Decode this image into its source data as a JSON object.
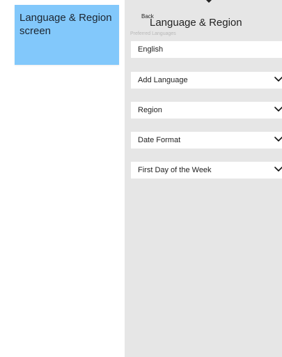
{
  "caption": {
    "text": "Language & Region screen"
  },
  "nav": {
    "back_label": "Back",
    "title": "Language & Region"
  },
  "section": {
    "header": "Preferred Languages"
  },
  "rows": [
    {
      "label": "English",
      "icon": "none"
    },
    {
      "label": "Add Language",
      "icon": "chevron-down-icon"
    },
    {
      "label": "Region",
      "icon": "chevron-down-icon"
    },
    {
      "label": "Date Format",
      "icon": "chevron-down-icon"
    },
    {
      "label": "First Day of the Week",
      "icon": "chevron-down-icon"
    }
  ],
  "colors": {
    "caption_bg": "#82c8fb",
    "screen_bg": "#e6e6e6",
    "row_bg": "#ffffff"
  }
}
